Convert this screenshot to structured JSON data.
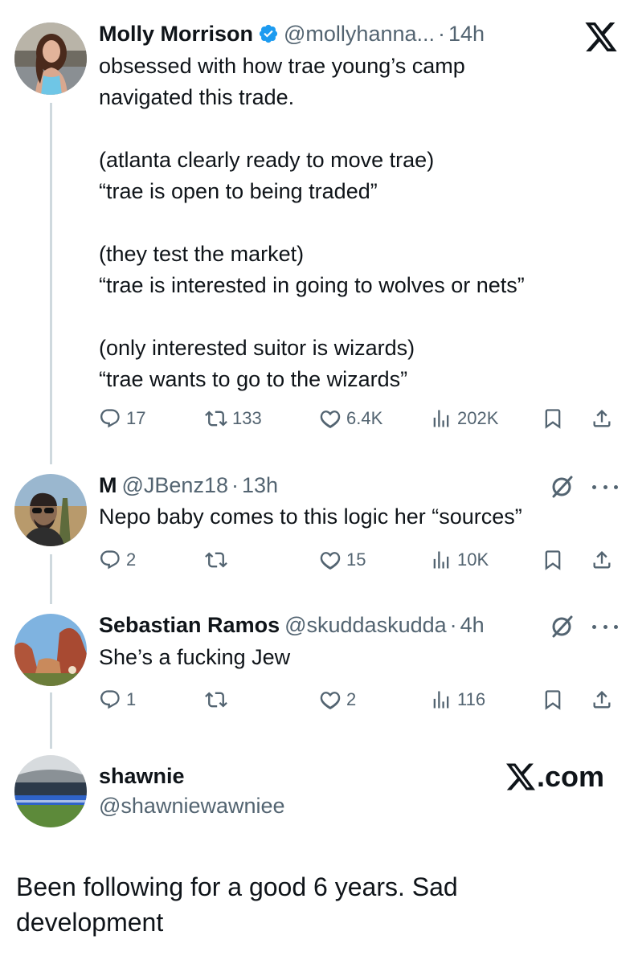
{
  "tweets": [
    {
      "name": "Molly Morrison",
      "handle": "@mollyhanna...",
      "time": "14h",
      "text": "obsessed with how trae young’s camp\nnavigated this trade.\n\n(atlanta clearly ready to move trae)\n“trae is open to being traded”\n\n(they test the market)\n“trae is interested in going to wolves or nets”\n\n(only interested suitor is wizards)\n“trae wants to go to the wizards”",
      "replies": "17",
      "reposts": "133",
      "likes": "6.4K",
      "views": "202K"
    },
    {
      "name": "M",
      "handle": "@JBenz18",
      "time": "13h",
      "text": "Nepo baby comes to this logic her “sources”",
      "replies": "2",
      "reposts": "",
      "likes": "15",
      "views": "10K"
    },
    {
      "name": "Sebastian Ramos",
      "handle": "@skuddaskudda",
      "time": "4h",
      "text": "She’s a fucking Jew",
      "replies": "1",
      "reposts": "",
      "likes": "2",
      "views": "116"
    }
  ],
  "separator": "·",
  "quoted_account": {
    "name": "shawnie",
    "handle": "@shawniewawniee",
    "site": ".com"
  },
  "caption": "Been following for a good 6 years. Sad development",
  "colors": {
    "text": "#0f1419",
    "secondary": "#536471",
    "verified": "#1d9bf0",
    "thread_line": "#cfd9de"
  },
  "icons": [
    "x-logo-icon",
    "verified-badge-icon",
    "reply-icon",
    "repost-icon",
    "like-icon",
    "views-icon",
    "bookmark-icon",
    "share-icon",
    "grok-icon",
    "more-icon"
  ]
}
